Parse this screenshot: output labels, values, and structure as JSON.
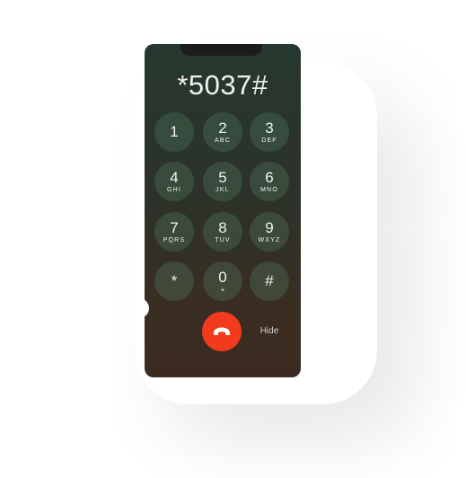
{
  "dialer": {
    "entered_number": "*5037#",
    "keys": [
      {
        "digit": "1",
        "letters": ""
      },
      {
        "digit": "2",
        "letters": "ABC"
      },
      {
        "digit": "3",
        "letters": "DEF"
      },
      {
        "digit": "4",
        "letters": "GHI"
      },
      {
        "digit": "5",
        "letters": "JKL"
      },
      {
        "digit": "6",
        "letters": "MNO"
      },
      {
        "digit": "7",
        "letters": "PQRS"
      },
      {
        "digit": "8",
        "letters": "TUV"
      },
      {
        "digit": "9",
        "letters": "WXYZ"
      },
      {
        "digit": "*",
        "letters": ""
      },
      {
        "digit": "0",
        "letters": "+"
      },
      {
        "digit": "#",
        "letters": ""
      }
    ],
    "end_call_icon": "phone-hangup-icon",
    "hide_label": "Hide"
  },
  "colors": {
    "end_call": "#f23b1e",
    "key_background": "rgba(90,140,110,0.28)",
    "text": "#f2f2f2"
  }
}
